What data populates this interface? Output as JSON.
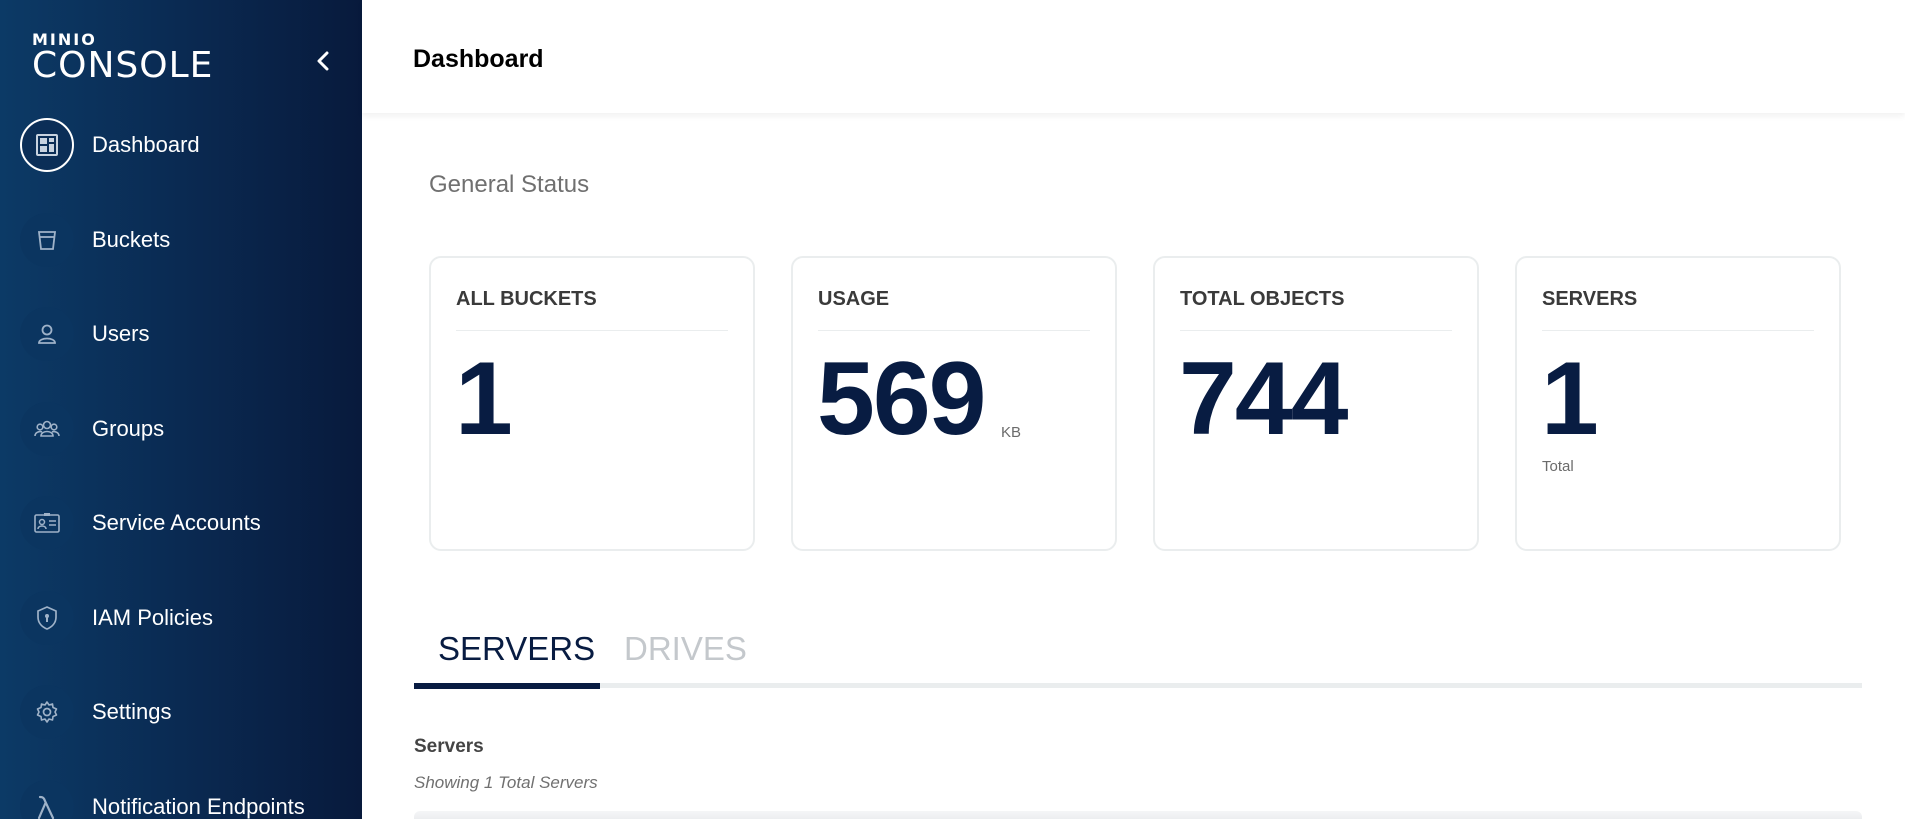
{
  "logo": {
    "small": "MINIO",
    "big": "CONSOLE"
  },
  "sidebar": {
    "items": [
      {
        "label": "Dashboard",
        "icon": "dashboard-icon",
        "active": true
      },
      {
        "label": "Buckets",
        "icon": "bucket-icon"
      },
      {
        "label": "Users",
        "icon": "user-icon"
      },
      {
        "label": "Groups",
        "icon": "groups-icon"
      },
      {
        "label": "Service Accounts",
        "icon": "id-card-icon"
      },
      {
        "label": "IAM Policies",
        "icon": "shield-icon"
      },
      {
        "label": "Settings",
        "icon": "gear-icon"
      },
      {
        "label": "Notification Endpoints",
        "icon": "lambda-icon"
      }
    ]
  },
  "header": {
    "title": "Dashboard"
  },
  "general_status": {
    "title": "General Status",
    "cards": [
      {
        "label": "ALL BUCKETS",
        "value": "1"
      },
      {
        "label": "USAGE",
        "value": "569",
        "unit": "KB"
      },
      {
        "label": "TOTAL OBJECTS",
        "value": "744"
      },
      {
        "label": "SERVERS",
        "value": "1",
        "unit": "Total"
      }
    ]
  },
  "tabs": [
    {
      "label": "SERVERS",
      "active": true
    },
    {
      "label": "DRIVES",
      "active": false
    }
  ],
  "servers_section": {
    "title": "Servers",
    "caption": "Showing 1 Total Servers"
  },
  "colors": {
    "sidebar_start": "#0c3a66",
    "sidebar_end": "#081a3c",
    "accent": "#081c42",
    "card_border": "#eaedee"
  }
}
